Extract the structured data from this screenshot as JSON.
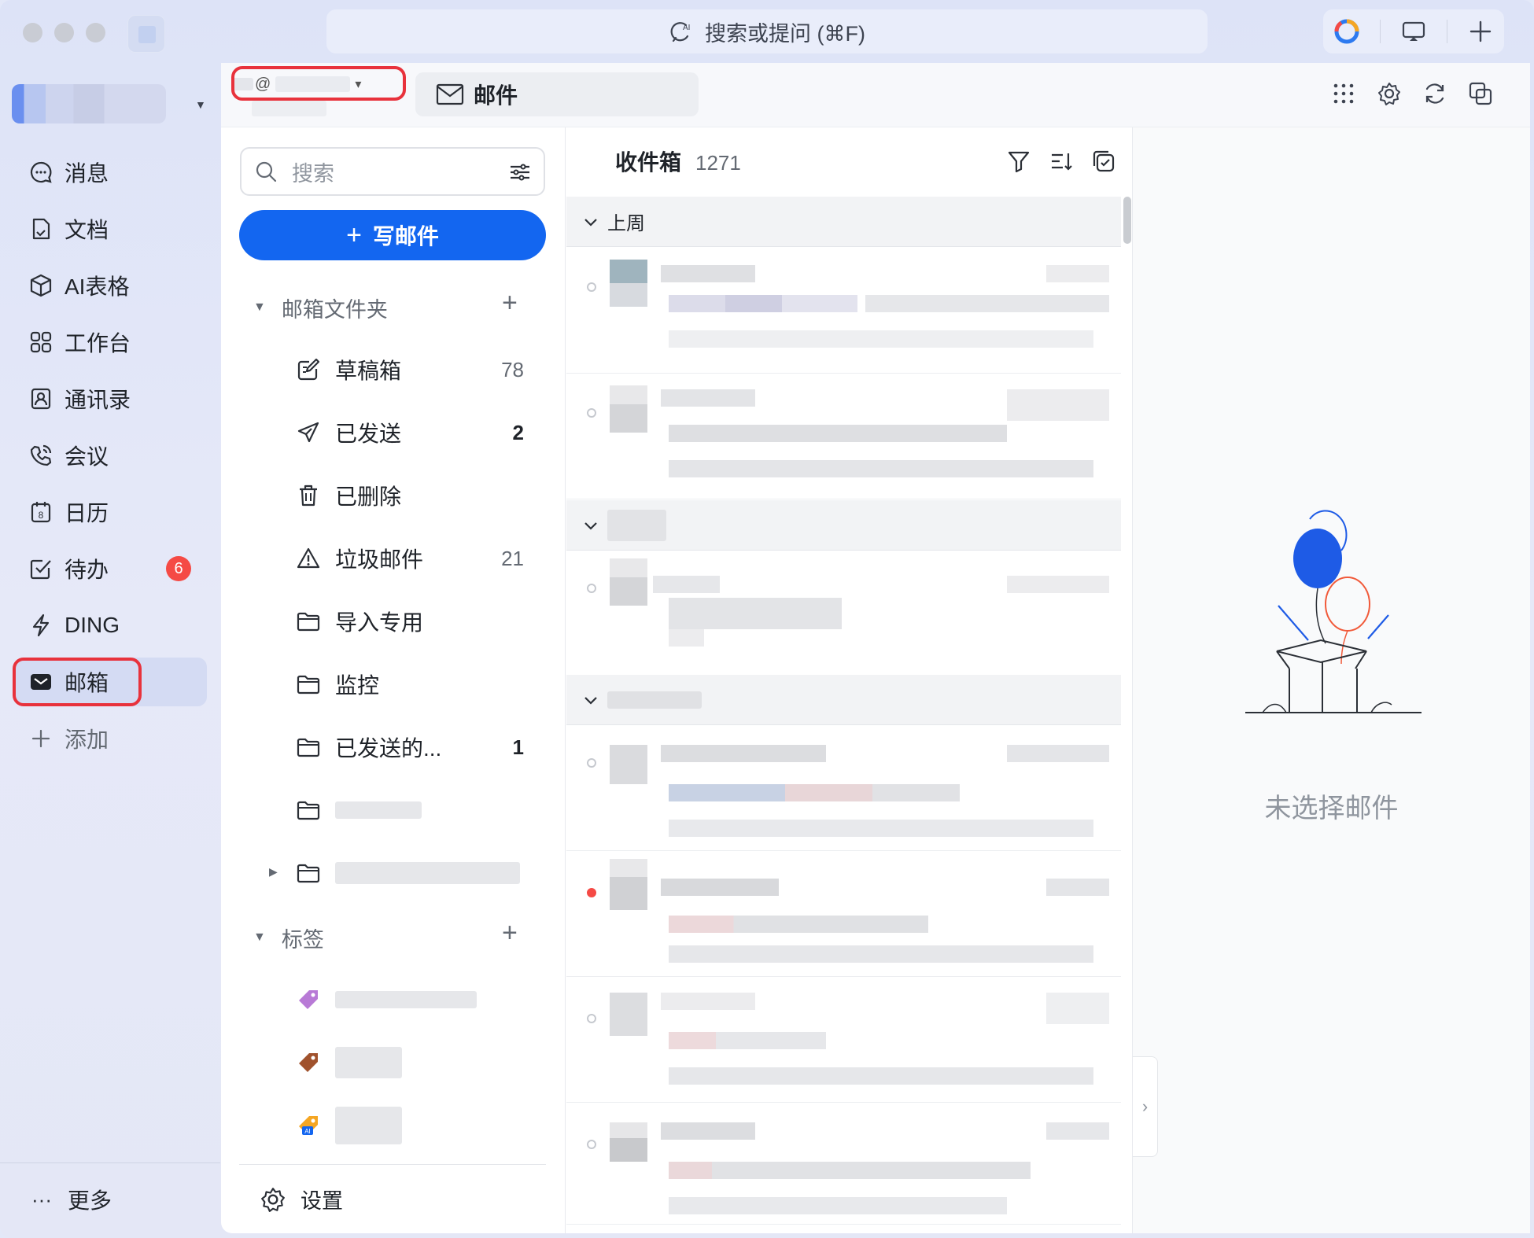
{
  "titlebar": {
    "search_placeholder": "搜索或提问 (⌘F)"
  },
  "nav": {
    "items": [
      {
        "label": "消息",
        "icon": "message-icon"
      },
      {
        "label": "文档",
        "icon": "docs-icon"
      },
      {
        "label": "AI表格",
        "icon": "ai-table-icon"
      },
      {
        "label": "工作台",
        "icon": "workbench-icon"
      },
      {
        "label": "通讯录",
        "icon": "contacts-icon"
      },
      {
        "label": "会议",
        "icon": "meeting-icon"
      },
      {
        "label": "日历",
        "icon": "calendar-icon"
      },
      {
        "label": "待办",
        "icon": "todo-icon",
        "badge": "6"
      },
      {
        "label": "DING",
        "icon": "ding-icon"
      },
      {
        "label": "邮箱",
        "icon": "mail-icon",
        "active": true
      },
      {
        "label": "添加",
        "icon": "plus-icon"
      }
    ],
    "calendar_day": "8",
    "more_label": "更多"
  },
  "account": {
    "at": "@",
    "caret": "▾"
  },
  "tab": {
    "label": "邮件"
  },
  "folders": {
    "search_placeholder": "搜索",
    "compose_label": "写邮件",
    "section_folders": "邮箱文件夹",
    "items": [
      {
        "label": "草稿箱",
        "count": "78"
      },
      {
        "label": "已发送",
        "count": "2"
      },
      {
        "label": "已删除",
        "count": ""
      },
      {
        "label": "垃圾邮件",
        "count": "21"
      },
      {
        "label": "导入专用",
        "count": ""
      },
      {
        "label": "监控",
        "count": ""
      },
      {
        "label": "已发送的...",
        "count": "1"
      }
    ],
    "section_tags": "标签",
    "tag_colors": [
      "#b87ad6",
      "#a0522d",
      "#f5a623"
    ],
    "tag_ai": "AI",
    "settings_label": "设置"
  },
  "mail_list": {
    "title": "收件箱",
    "count": "1271",
    "group_label": "上周"
  },
  "preview": {
    "empty_text": "未选择邮件"
  },
  "colors": {
    "accent": "#1366f0",
    "badge": "#f54a45",
    "highlight": "#e8323c"
  }
}
